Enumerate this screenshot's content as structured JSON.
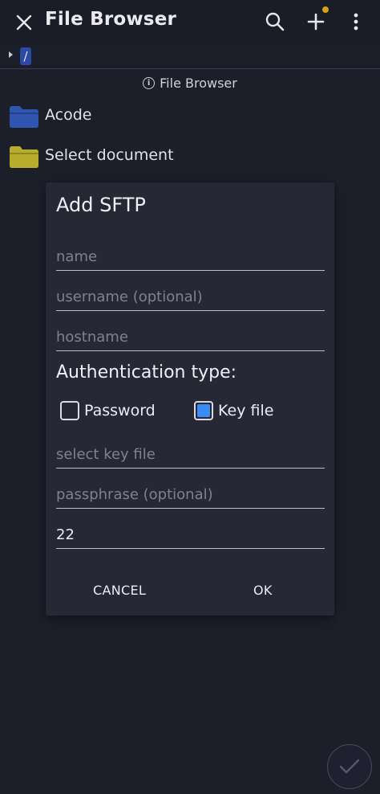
{
  "colors": {
    "background": "#1c1e2a",
    "dialog": "#262835",
    "accent_checkbox": "#3b8cf2",
    "notification_dot": "#d4a418",
    "folder_blue": "#2f55b0",
    "folder_yellow": "#b6ad2c",
    "crumb_bg": "#2b4aa3"
  },
  "appbar": {
    "title": "File Browser",
    "close_icon": "close-icon",
    "search_icon": "search-icon",
    "add_icon": "add-icon",
    "more_icon": "more-vertical-icon"
  },
  "path": {
    "crumb": "/"
  },
  "info": {
    "label": "File Browser",
    "icon": "info-icon"
  },
  "files": [
    {
      "name": "Acode",
      "icon": "folder-icon"
    },
    {
      "name": "Select document",
      "icon": "folder-icon"
    }
  ],
  "dialog": {
    "title": "Add SFTP",
    "fields": {
      "name_placeholder": "name",
      "username_placeholder": "username (optional)",
      "hostname_placeholder": "hostname",
      "keyfile_placeholder": "select key file",
      "passphrase_placeholder": "passphrase (optional)",
      "port_value": "22"
    },
    "auth_label": "Authentication type:",
    "auth_options": [
      {
        "label": "Password",
        "checked": false
      },
      {
        "label": "Key file",
        "checked": true
      }
    ],
    "cancel_label": "CANCEL",
    "ok_label": "OK"
  },
  "fab": {
    "icon": "check-icon"
  }
}
